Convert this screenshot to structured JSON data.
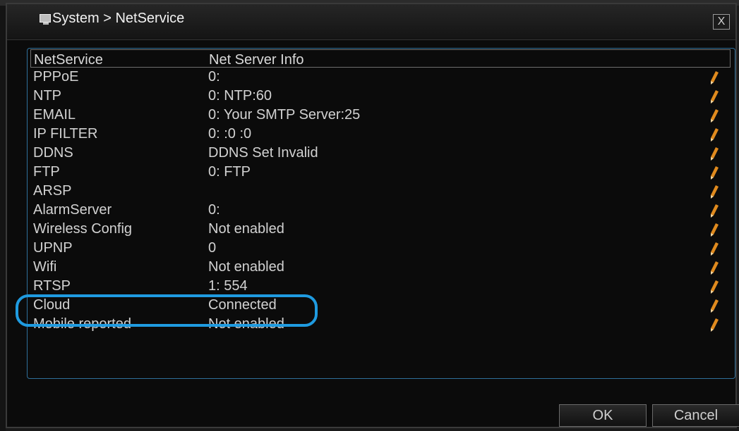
{
  "window": {
    "title": "System > NetService",
    "close_label": "X"
  },
  "table": {
    "headers": [
      "NetService",
      "Net Server Info"
    ],
    "rows": [
      {
        "name": "PPPoE",
        "info": "0:"
      },
      {
        "name": "NTP",
        "info": "0: NTP:60"
      },
      {
        "name": "EMAIL",
        "info": "0: Your SMTP Server:25"
      },
      {
        "name": "IP FILTER",
        "info": "0: :0 :0"
      },
      {
        "name": "DDNS",
        "info": "DDNS Set Invalid"
      },
      {
        "name": "FTP",
        "info": "0: FTP"
      },
      {
        "name": "ARSP",
        "info": ""
      },
      {
        "name": "AlarmServer",
        "info": "0:"
      },
      {
        "name": "Wireless Config",
        "info": "Not enabled"
      },
      {
        "name": "UPNP",
        "info": "0"
      },
      {
        "name": "Wifi",
        "info": "Not enabled"
      },
      {
        "name": "RTSP",
        "info": "1: 554"
      },
      {
        "name": "Cloud",
        "info": "Connected"
      },
      {
        "name": "Mobile reported",
        "info": "Not enabled"
      }
    ]
  },
  "buttons": {
    "ok": "OK",
    "cancel": "Cancel"
  },
  "colors": {
    "highlight": "#1f9be0",
    "edit_icon": "#e08a1e"
  },
  "icons": {
    "title": "monitor-icon",
    "edit": "pencil-icon",
    "close": "close-icon"
  }
}
